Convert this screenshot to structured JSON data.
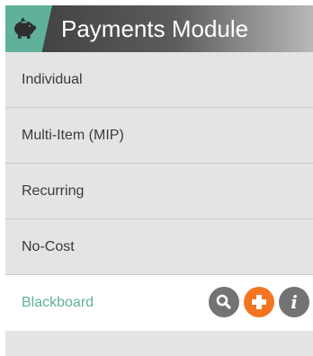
{
  "header": {
    "title": "Payments Module",
    "icon": "piggy-bank-icon",
    "accent_color": "#5fb19b"
  },
  "menu": {
    "items": [
      {
        "label": "Individual"
      },
      {
        "label": "Multi-Item (MIP)"
      },
      {
        "label": "Recurring"
      },
      {
        "label": "No-Cost"
      },
      {
        "label": "Blackboard",
        "active": true
      }
    ]
  },
  "actions": {
    "search_icon": "magnifier-icon",
    "add_icon": "plus-icon",
    "add_color": "#f47521",
    "info_glyph": "i"
  }
}
